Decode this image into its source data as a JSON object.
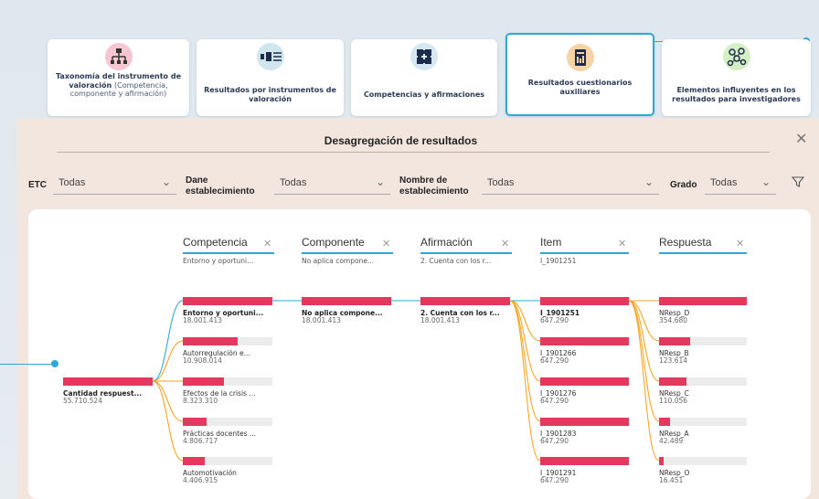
{
  "nav_cards": [
    {
      "title": "Taxonomía del instrumento de valoración",
      "subtitle": "(Competencia, componente y afirmación)",
      "icon": "hierarchy-icon"
    },
    {
      "title": "Resultados por instrumentos de valoración",
      "icon": "slider-bars-icon"
    },
    {
      "title": "Competencias y afirmaciones",
      "icon": "puzzle-icon"
    },
    {
      "title": "Resultados cuestionarios auxiliares",
      "icon": "report-document-icon"
    },
    {
      "title": "Elementos influyentes en los resultados para investigadores",
      "icon": "network-molecule-icon"
    }
  ],
  "panel": {
    "title": "Desagregación de resultados"
  },
  "filters": {
    "etc": {
      "label": "ETC",
      "value": "Todas"
    },
    "dane": {
      "label": "Dane establecimiento",
      "value": "Todas"
    },
    "nombre": {
      "label": "Nombre de establecimiento",
      "value": "Todas"
    },
    "grado": {
      "label": "Grado",
      "value": "Todas"
    }
  },
  "columns": [
    {
      "name": "Competencia",
      "filter": "Entorno y oportuni..."
    },
    {
      "name": "Componente",
      "filter": "No aplica compone..."
    },
    {
      "name": "Afirmación",
      "filter": "2. Cuenta con los r..."
    },
    {
      "name": "Item",
      "filter": "I_1901251"
    },
    {
      "name": "Respuesta",
      "filter": ""
    }
  ],
  "root": {
    "label": "Cantidad respuest...",
    "value": "55.710.524"
  },
  "competencia_nodes": [
    {
      "label": "Entorno y oportuni...",
      "value": "18.001.413",
      "fill": 1.0
    },
    {
      "label": "Autorregulación e...",
      "value": "10.908.014",
      "fill": 0.61
    },
    {
      "label": "Efectos de la crisis ...",
      "value": "8.323.310",
      "fill": 0.46
    },
    {
      "label": "Prácticas docentes ...",
      "value": "4.806.717",
      "fill": 0.27
    },
    {
      "label": "Automotivación",
      "value": "4.406.915",
      "fill": 0.24
    }
  ],
  "componente_nodes": [
    {
      "label": "No aplica compone...",
      "value": "18.001.413",
      "fill": 1.0
    }
  ],
  "afirmacion_nodes": [
    {
      "label": "2. Cuenta con los r...",
      "value": "18.001.413",
      "fill": 1.0
    }
  ],
  "item_nodes": [
    {
      "label": "I_1901251",
      "value": "647.290",
      "fill": 1.0
    },
    {
      "label": "I_1901266",
      "value": "647.290",
      "fill": 1.0
    },
    {
      "label": "I_1901276",
      "value": "647.290",
      "fill": 1.0
    },
    {
      "label": "I_1901283",
      "value": "647.290",
      "fill": 1.0
    },
    {
      "label": "I_1901291",
      "value": "647.290",
      "fill": 1.0
    }
  ],
  "respuesta_nodes": [
    {
      "label": "NResp_D",
      "value": "354.680",
      "fill": 1.0
    },
    {
      "label": "NResp_B",
      "value": "123.614",
      "fill": 0.35
    },
    {
      "label": "NResp_C",
      "value": "110.056",
      "fill": 0.31
    },
    {
      "label": "NResp_A",
      "value": "42.489",
      "fill": 0.12
    },
    {
      "label": "NResp_O",
      "value": "16.451",
      "fill": 0.05
    }
  ],
  "colors": {
    "accent": "#2ea8d8",
    "bar": "#e23a5e",
    "link_selected": "#2ea8d8",
    "link_other": "#f5a623"
  }
}
